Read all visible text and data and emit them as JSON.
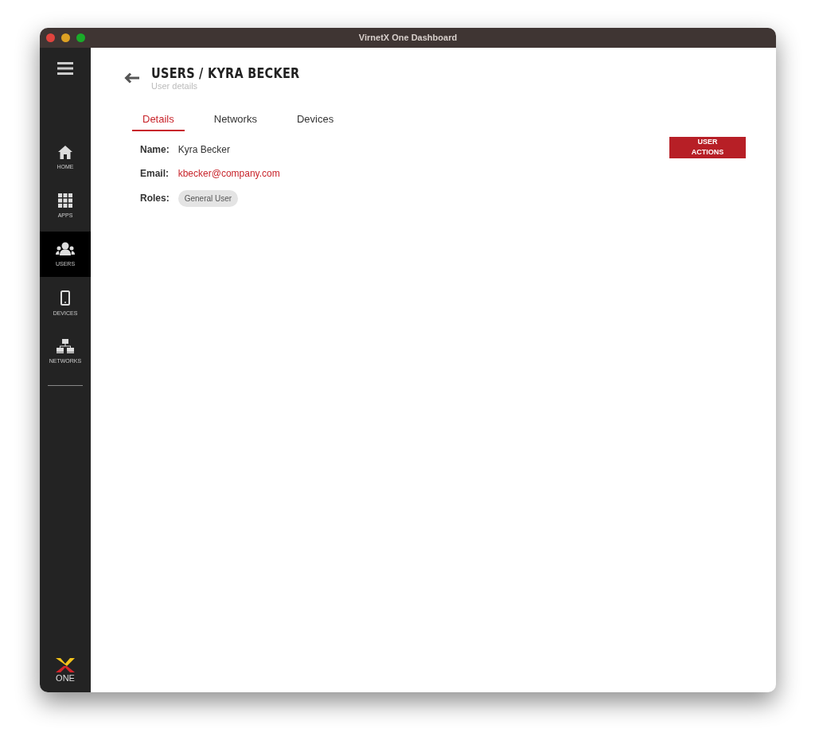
{
  "window": {
    "title": "VirnetX One Dashboard"
  },
  "sidebar": {
    "items": [
      {
        "label": "HOME",
        "kind": "home",
        "selected": false
      },
      {
        "label": "APPS",
        "kind": "apps",
        "selected": false
      },
      {
        "label": "USERS",
        "kind": "users",
        "selected": true
      },
      {
        "label": "DEVICES",
        "kind": "devices",
        "selected": false
      },
      {
        "label": "NETWORKS",
        "kind": "networks",
        "selected": false
      }
    ],
    "logo_text": "ONE"
  },
  "header": {
    "title": "USERS / KYRA BECKER",
    "subtitle": "User details"
  },
  "tabs": [
    {
      "label": "Details",
      "selected": true
    },
    {
      "label": "Networks",
      "selected": false
    },
    {
      "label": "Devices",
      "selected": false
    }
  ],
  "details": {
    "name_label": "Name:",
    "name": "Kyra Becker",
    "email_label": "Email:",
    "email": "kbecker@company.com",
    "roles_label": "Roles:",
    "roles": [
      "General User"
    ]
  },
  "user_actions_button": "USER ACTIONS"
}
